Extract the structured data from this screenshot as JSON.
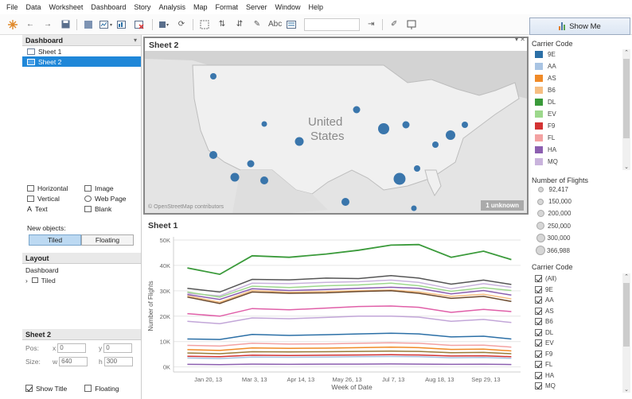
{
  "menu": [
    "File",
    "Data",
    "Worksheet",
    "Dashboard",
    "Story",
    "Analysis",
    "Map",
    "Format",
    "Server",
    "Window",
    "Help"
  ],
  "toolbar": {
    "abc_label": "Abc"
  },
  "show_me": {
    "label": "Show Me",
    "bar_colors": [
      "#e57f2a",
      "#4e79a7",
      "#59a14f"
    ]
  },
  "left_pane": {
    "dashboard_header": "Dashboard",
    "sheets": [
      {
        "label": "Sheet 1"
      },
      {
        "label": "Sheet 2"
      }
    ],
    "objects": [
      {
        "label": "Horizontal",
        "icon": "horizontal-icon"
      },
      {
        "label": "Image",
        "icon": "image-icon"
      },
      {
        "label": "Vertical",
        "icon": "vertical-icon"
      },
      {
        "label": "Web Page",
        "icon": "globe-icon"
      },
      {
        "label": "Text",
        "icon": "text-icon"
      },
      {
        "label": "Blank",
        "icon": "blank-icon"
      }
    ],
    "new_objects_label": "New objects:",
    "tiled_label": "Tiled",
    "floating_label": "Floating",
    "layout_header": "Layout",
    "layout_dashboard": "Dashboard",
    "layout_tiled": "Tiled",
    "sheet2_header": "Sheet 2",
    "pos_label": "Pos:",
    "size_label": "Size:",
    "x_label": "x",
    "x_value": "0",
    "y_label": "y",
    "y_value": "0",
    "w_label": "w",
    "w_value": "640",
    "h_label": "h",
    "h_value": "300",
    "show_title_label": "Show Title",
    "floating_check_label": "Floating"
  },
  "map": {
    "title": "Sheet 2",
    "country_label_1": "United",
    "country_label_2": "States",
    "attribution": "© OpenStreetMap contributors",
    "unknown_badge": "1 unknown",
    "marker_color": "#2f6fa8"
  },
  "legend": {
    "carrier_title": "Carrier Code",
    "carriers": [
      {
        "code": "9E",
        "color": "#2b6fa6"
      },
      {
        "code": "AA",
        "color": "#a9c4e3"
      },
      {
        "code": "AS",
        "color": "#f08a27"
      },
      {
        "code": "B6",
        "color": "#f6be82"
      },
      {
        "code": "DL",
        "color": "#3a9a3a"
      },
      {
        "code": "EV",
        "color": "#9dd88c"
      },
      {
        "code": "F9",
        "color": "#d33333"
      },
      {
        "code": "FL",
        "color": "#f3a2a2"
      },
      {
        "code": "HA",
        "color": "#8c5fb0"
      },
      {
        "code": "MQ",
        "color": "#c9b3dc"
      }
    ],
    "flights_title": "Number of Flights",
    "flights_sizes": [
      "92,417",
      "150,000",
      "200,000",
      "250,000",
      "300,000",
      "366,988"
    ],
    "filter_title": "Carrier Code",
    "filter_items": [
      "(All)",
      "9E",
      "AA",
      "AS",
      "B6",
      "DL",
      "EV",
      "F9",
      "FL",
      "HA",
      "MQ"
    ]
  },
  "chart_data": {
    "type": "line",
    "title": "Sheet 1",
    "xlabel": "Week of Date",
    "ylabel": "Number of Flights",
    "ylim": [
      -2000,
      50000
    ],
    "y_ticks": [
      0,
      10000,
      20000,
      30000,
      40000,
      50000
    ],
    "y_tick_labels": [
      "0K",
      "10K",
      "20K",
      "30K",
      "40K",
      "50K"
    ],
    "x_ticks": [
      {
        "label": "Jan 20, 13",
        "x": 1.5
      },
      {
        "label": "Mar 3, 13",
        "x": 3.5
      },
      {
        "label": "Apr 14, 13",
        "x": 5.5
      },
      {
        "label": "May 26, 13",
        "x": 7.5
      },
      {
        "label": "Jul 7, 13",
        "x": 9.5
      },
      {
        "label": "Aug 18, 13",
        "x": 11.5
      },
      {
        "label": "Sep 29, 13",
        "x": 13.5
      }
    ],
    "xlim": [
      0,
      15
    ],
    "x": [
      0.6,
      2,
      3.4,
      5,
      6.6,
      8,
      9.4,
      10.6,
      12,
      13.4,
      14.6
    ],
    "series": [
      {
        "color": "#3a9a3a",
        "values": [
          39000,
          36500,
          43800,
          43200,
          44500,
          46000,
          48000,
          48200,
          43200,
          45600,
          42300
        ]
      },
      {
        "color": "#555555",
        "values": [
          31000,
          29500,
          34500,
          34300,
          35000,
          34800,
          36000,
          35000,
          32600,
          34200,
          32500
        ]
      },
      {
        "color": "#c9b3dc",
        "values": [
          29000,
          28000,
          33000,
          32800,
          33300,
          33600,
          34200,
          33300,
          30800,
          32800,
          31400
        ]
      },
      {
        "color": "#9dd88c",
        "values": [
          29500,
          27500,
          31800,
          31300,
          32000,
          32300,
          33000,
          32000,
          29800,
          31200,
          30100
        ]
      },
      {
        "color": "#8c5fb0",
        "values": [
          28500,
          26600,
          30800,
          30100,
          30500,
          31000,
          31400,
          31000,
          28800,
          30100,
          28300
        ]
      },
      {
        "color": "#f6be82",
        "values": [
          28000,
          25500,
          30100,
          29400,
          29700,
          30000,
          30300,
          29500,
          27800,
          28600,
          26800
        ]
      },
      {
        "color": "#6b4a2e",
        "values": [
          27500,
          25000,
          29500,
          29000,
          29200,
          29700,
          30000,
          29000,
          27000,
          27800,
          25800
        ]
      },
      {
        "color": "#e05fa8",
        "values": [
          21000,
          20000,
          23000,
          22500,
          23200,
          23800,
          24000,
          23500,
          21500,
          22700,
          21800
        ]
      },
      {
        "color": "#c2a6d8",
        "values": [
          18000,
          17000,
          19300,
          19000,
          19500,
          20000,
          20000,
          19600,
          18000,
          18700,
          17500
        ]
      },
      {
        "color": "#2b6fa6",
        "values": [
          11000,
          10800,
          12800,
          12400,
          12700,
          13000,
          13300,
          13000,
          11800,
          12100,
          11000
        ]
      },
      {
        "color": "#f3a2a2",
        "values": [
          8500,
          8200,
          9300,
          9000,
          9100,
          9300,
          9500,
          9300,
          8500,
          8600,
          7800
        ]
      },
      {
        "color": "#f08a27",
        "values": [
          6800,
          6500,
          7500,
          7300,
          7400,
          7600,
          7800,
          7600,
          6900,
          7000,
          6300
        ]
      },
      {
        "color": "#9a7d3a",
        "values": [
          5500,
          5200,
          6000,
          5900,
          6000,
          6100,
          6200,
          6100,
          5600,
          5700,
          5200
        ]
      },
      {
        "color": "#d33333",
        "values": [
          4200,
          4000,
          4600,
          4500,
          4600,
          4700,
          4800,
          4700,
          4300,
          4400,
          4000
        ]
      },
      {
        "color": "#a9c4e3",
        "values": [
          3500,
          3300,
          3900,
          3800,
          3900,
          4000,
          4100,
          4000,
          3600,
          3700,
          3400
        ]
      },
      {
        "color": "#8c5fb0",
        "values": [
          1000,
          900,
          1100,
          1000,
          1100,
          1100,
          1150,
          1100,
          1000,
          1050,
          950
        ]
      }
    ]
  }
}
